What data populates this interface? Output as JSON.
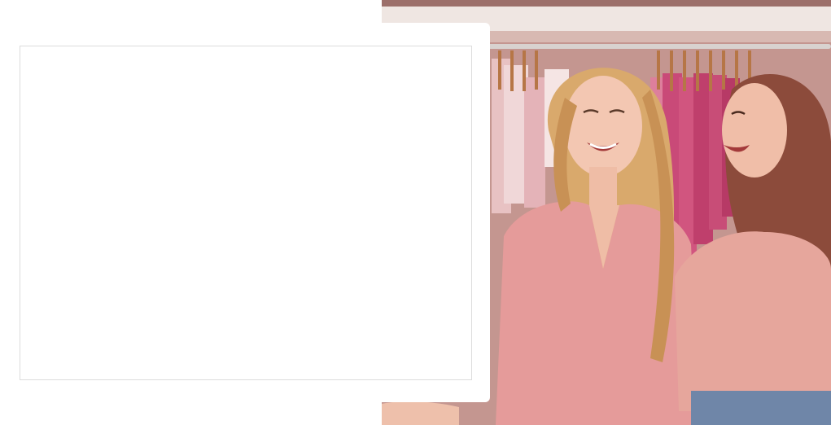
{
  "scene": {
    "photo_description": "",
    "colors": {
      "background": "#ffffff",
      "card_border": "#dcdcdc",
      "wall_pink": "#c89a94",
      "shelf": "#e9dcd6",
      "hanger_wood": "#c98a5a",
      "garment_pink": "#d46a8c",
      "garment_magenta": "#c23f6f",
      "blouse_pink": "#e79a9a",
      "top_pink": "#e7a39a",
      "hair_blonde": "#d8a86a",
      "hair_brown": "#8a4a3a",
      "skin": "#f1c2ad"
    }
  },
  "card": {
    "content_text": ""
  }
}
